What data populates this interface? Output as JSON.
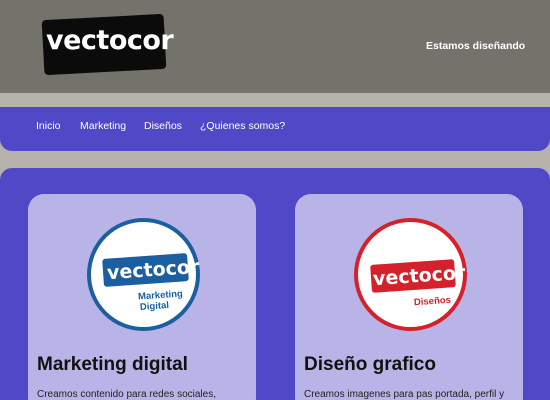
{
  "header": {
    "logo_text": "vectocor",
    "tagline": "Estamos diseñando"
  },
  "nav": {
    "items": [
      "Inicio",
      "Marketing",
      "Diseños",
      "¿Quienes somos?"
    ]
  },
  "cards": [
    {
      "badge_word": "vectocor",
      "badge_sub_1": "Marketing",
      "badge_sub_2": "Digital",
      "title": "Marketing digital",
      "text": "Creamos contenido para redes sociales,"
    },
    {
      "badge_word": "vectocor",
      "badge_sub_1": "Diseños",
      "title": "Diseño grafico",
      "text": "Creamos imagenes para pas portada, perfil y"
    }
  ],
  "colors": {
    "header_bg": "#73736c",
    "accent_purple": "#5148c8",
    "card_bg": "#b9b4e7",
    "marketing_blue": "#1c5fa0",
    "design_red": "#d4212b"
  }
}
